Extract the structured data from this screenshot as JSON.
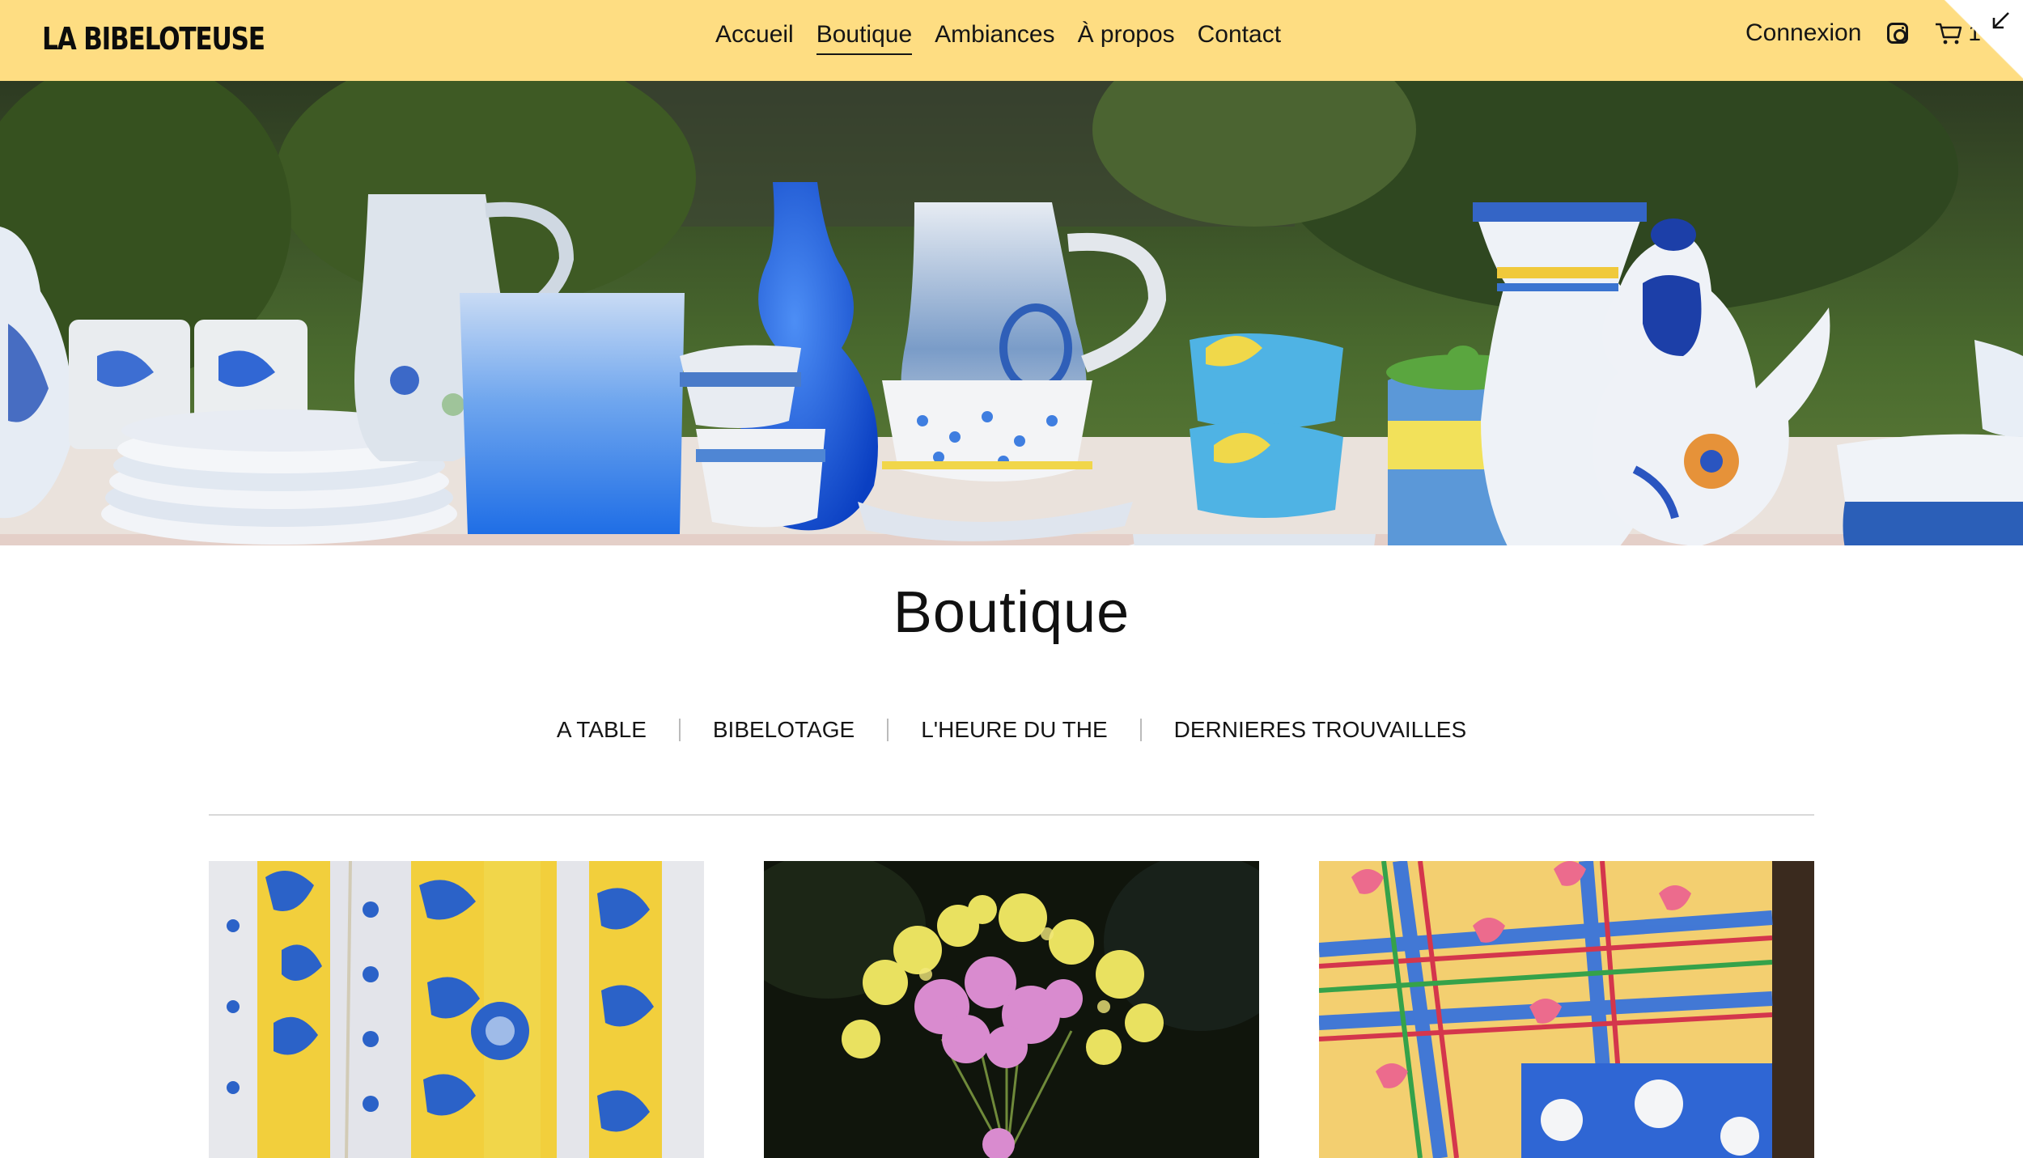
{
  "header": {
    "logo": "LA BIBELOTEUSE",
    "nav": [
      {
        "label": "Accueil",
        "active": false
      },
      {
        "label": "Boutique",
        "active": true
      },
      {
        "label": "Ambiances",
        "active": false
      },
      {
        "label": "À propos",
        "active": false
      },
      {
        "label": "Contact",
        "active": false
      }
    ],
    "login_label": "Connexion",
    "cart_count": "1"
  },
  "hero": {
    "icon": "hero-tableware-image"
  },
  "page_title": "Boutique",
  "categories": [
    "A TABLE",
    "BIBELOTAGE",
    "L'HEURE DU THE",
    "DERNIERES TROUVAILLES"
  ],
  "products": [
    {
      "image": "blue-yellow-provencal-tablecloth"
    },
    {
      "image": "dried-flower-bouquet"
    },
    {
      "image": "colorful-floral-tablecloth"
    }
  ],
  "colors": {
    "header_bg": "#fedd82",
    "text": "#111111",
    "accent_blue": "#1f5fd0"
  }
}
